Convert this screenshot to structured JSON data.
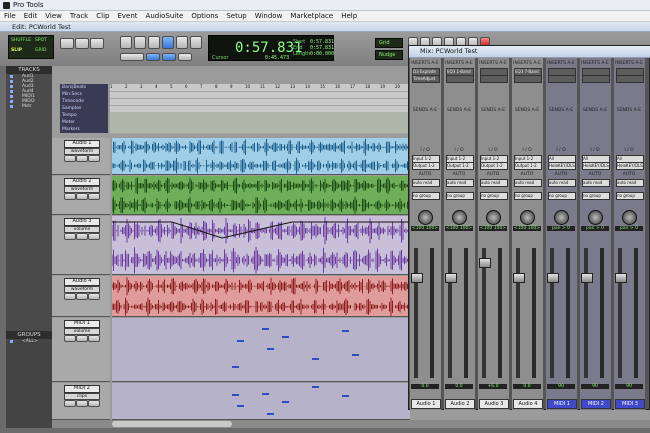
{
  "app": {
    "title": "Pro Tools",
    "edit_title": "Edit: PCWorld Test",
    "mix_title": "Mix: PCWorld Test"
  },
  "menu": [
    "File",
    "Edit",
    "View",
    "Track",
    "Clip",
    "Event",
    "AudioSuite",
    "Options",
    "Setup",
    "Window",
    "Marketplace",
    "Help"
  ],
  "toolbar": {
    "mode1": "SHUFFLE",
    "mode2": "SPOT",
    "mode3": "SLIP",
    "mode4": "GRID"
  },
  "counter": {
    "main": "0:57.831",
    "start_label": "Start",
    "end_label": "End",
    "length_label": "Length",
    "start": "0:57.831",
    "end": "0:57.831",
    "length": "0:00.000",
    "cursor_label": "Cursor",
    "cursor": "0:45.473",
    "nudge": "Nudge",
    "grid": "Grid"
  },
  "tracks_panel": {
    "header": "TRACKS",
    "items": [
      "Aud1",
      "Aud2",
      "Aud3",
      "Aud4",
      "MIDI1",
      "MIDI2",
      "Mstr"
    ],
    "groups_header": "GROUPS",
    "groups_all": "<ALL>"
  },
  "ruler": {
    "labels": [
      "Bars|Beats",
      "Min:Secs",
      "Timecode",
      "Samples",
      "Tempo",
      "Meter",
      "Markers"
    ]
  },
  "ruler_marks": [
    "1",
    "2",
    "3",
    "4",
    "5",
    "6",
    "7",
    "8",
    "9",
    "10",
    "11",
    "12",
    "13",
    "14",
    "15",
    "16",
    "17",
    "18",
    "19",
    "20"
  ],
  "edit_tracks": [
    {
      "name": "Audio 1",
      "view": "waveform",
      "color": "#9fcfe8",
      "wave": "#1c5f8a"
    },
    {
      "name": "Audio 2",
      "view": "waveform",
      "color": "#6faf5a",
      "wave": "#1c4d16"
    },
    {
      "name": "Audio 3",
      "view": "volume",
      "color": "#c8c0d9",
      "wave": "#6d3ca0"
    },
    {
      "name": "Audio 4",
      "view": "waveform",
      "color": "#e09b9b",
      "wave": "#8b1f1f"
    },
    {
      "name": "MIDI 1",
      "view": "volume",
      "color": "#b6b2c9",
      "wave": "#2b4fbf"
    },
    {
      "name": "MIDI 2",
      "view": "clips",
      "color": "#b6b2c9",
      "wave": "#2b4fbf"
    }
  ],
  "mixer": {
    "section_inserts": "INSERTS A-E",
    "section_sends": "SENDS A-E",
    "io": "I / O",
    "auto": "AUTO",
    "group": "no group",
    "strips": [
      {
        "name": "Audio 1",
        "insert": "D3 Explode",
        "insert2": "TimeAdjust",
        "input": "Input 1-2",
        "output": "Output 1-2",
        "auto": "auto read",
        "pan": "<100 100>",
        "level": "0.0",
        "midi": false
      },
      {
        "name": "Audio 2",
        "insert": "EQ3 1-Band",
        "insert2": "",
        "input": "Input 1-2",
        "output": "Output 1-2",
        "auto": "auto read",
        "pan": "<100 100>",
        "level": "0.0",
        "midi": false
      },
      {
        "name": "Audio 3",
        "insert": "",
        "insert2": "",
        "input": "Input 1-2",
        "output": "Output 1-2",
        "auto": "auto read",
        "pan": "<100 100>",
        "level": "+6.0",
        "midi": false
      },
      {
        "name": "Audio 4",
        "insert": "EQ3 7-Band",
        "insert2": "",
        "input": "Input 1-2",
        "output": "Output 1-2",
        "auto": "auto read",
        "pan": "<100 100>",
        "level": "0.0",
        "midi": false
      },
      {
        "name": "MIDI 1",
        "insert": "",
        "insert2": "",
        "input": "All",
        "output": "HoloKEY/DLS",
        "auto": "auto read",
        "pan": "pan > 0",
        "level": "90",
        "midi": true
      },
      {
        "name": "MIDI 2",
        "insert": "",
        "insert2": "",
        "input": "All",
        "output": "HoloKEY/DLS",
        "auto": "auto read",
        "pan": "pan > 0",
        "level": "90",
        "midi": true
      },
      {
        "name": "MIDI 3",
        "insert": "",
        "insert2": "",
        "input": "All",
        "output": "HoloKEY/DLS",
        "auto": "auto read",
        "pan": "pan > 0",
        "level": "90",
        "midi": true
      }
    ]
  }
}
